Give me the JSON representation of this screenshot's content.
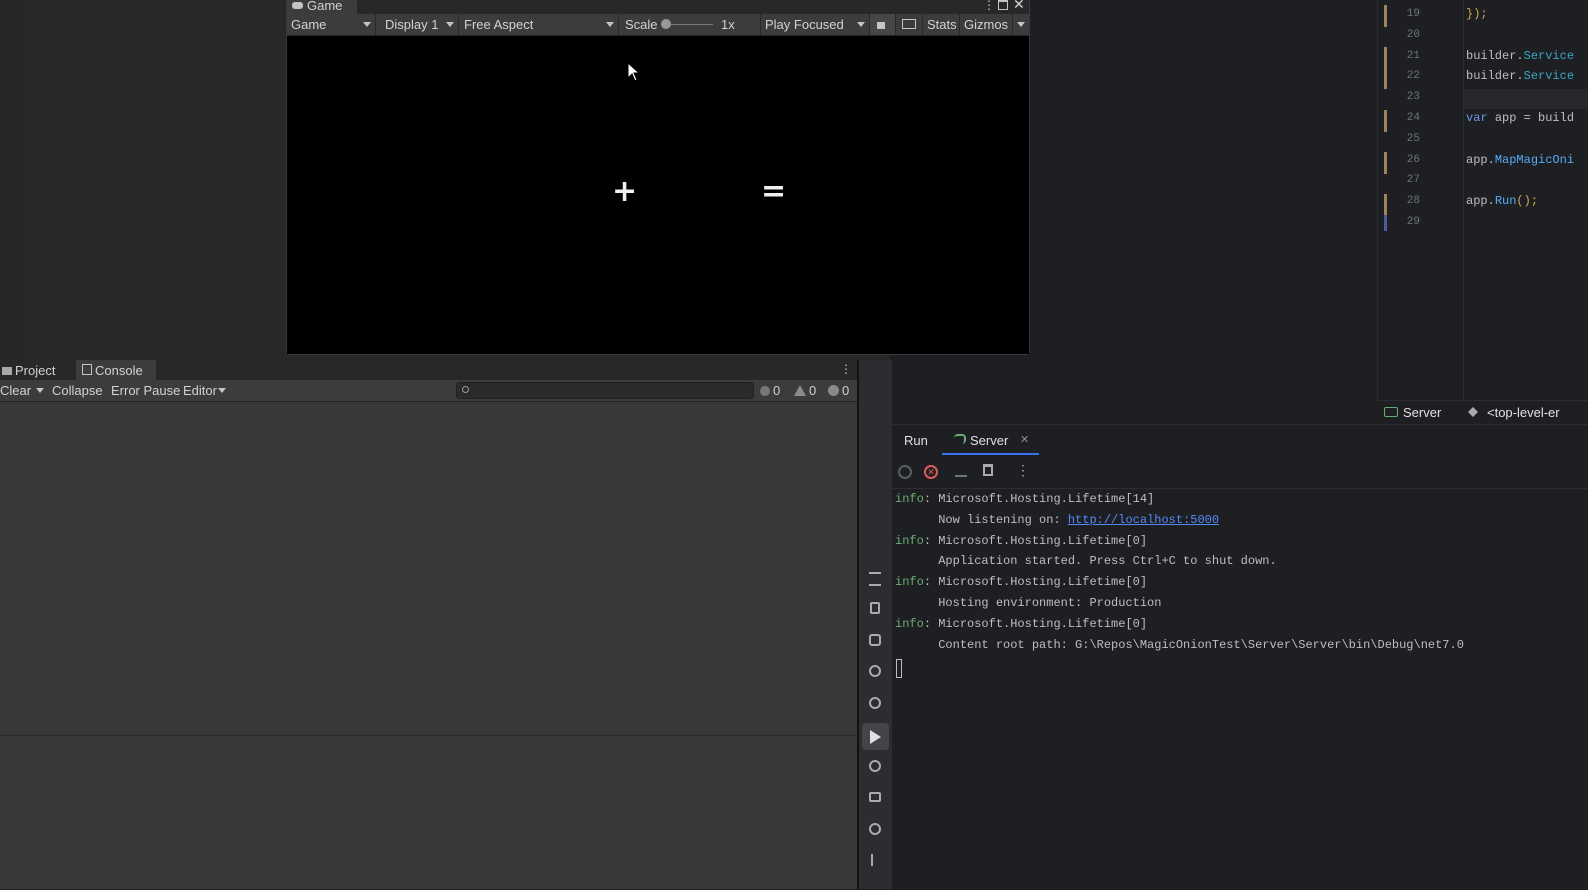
{
  "game": {
    "tab_label": "Game",
    "dropdown_game": "Game",
    "display": "Display 1",
    "aspect": "Free Aspect",
    "scale_label": "Scale",
    "scale_value": "1x",
    "play_mode": "Play Focused",
    "stats": "Stats",
    "gizmos": "Gizmos",
    "content_plus": "+",
    "content_equals": "="
  },
  "console": {
    "tabs": [
      "Project",
      "Console"
    ],
    "clear": "Clear",
    "collapse": "Collapse",
    "error_pause": "Error Pause",
    "editor": "Editor",
    "search_placeholder": "",
    "counts": {
      "info": "0",
      "warnings": "0",
      "errors": "0"
    }
  },
  "editor": {
    "lines": [
      {
        "num": "19",
        "code": "});"
      },
      {
        "num": "20",
        "code": ""
      },
      {
        "num": "21",
        "code": "builder.Service"
      },
      {
        "num": "22",
        "code": "builder.Service"
      },
      {
        "num": "23",
        "code": ""
      },
      {
        "num": "24",
        "code": "var app = build"
      },
      {
        "num": "25",
        "code": ""
      },
      {
        "num": "26",
        "code": "app.MapMagicOni"
      },
      {
        "num": "27",
        "code": ""
      },
      {
        "num": "28",
        "code": "app.Run();"
      },
      {
        "num": "29",
        "code": ""
      }
    ],
    "breadcrumb_project": "Server",
    "breadcrumb_scope": "<top-level-er"
  },
  "run": {
    "title": "Run",
    "config_tab": "Server",
    "log": [
      {
        "prefix": "info",
        "text": "Microsoft.Hosting.Lifetime[14]"
      },
      {
        "prefix": "",
        "text": "Now listening on: ",
        "link": "http://localhost:5000"
      },
      {
        "prefix": "info",
        "text": "Microsoft.Hosting.Lifetime[0]"
      },
      {
        "prefix": "",
        "text": "Application started. Press Ctrl+C to shut down."
      },
      {
        "prefix": "info",
        "text": "Microsoft.Hosting.Lifetime[0]"
      },
      {
        "prefix": "",
        "text": "Hosting environment: Production"
      },
      {
        "prefix": "info",
        "text": "Microsoft.Hosting.Lifetime[0]"
      },
      {
        "prefix": "",
        "text": "Content root path: G:\\Repos\\MagicOnionTest\\Server\\Server\\bin\\Debug\\net7.0"
      }
    ]
  },
  "colors": {
    "info_prefix": "#6aab73",
    "link": "#548af7",
    "accent": "#3574f0"
  }
}
